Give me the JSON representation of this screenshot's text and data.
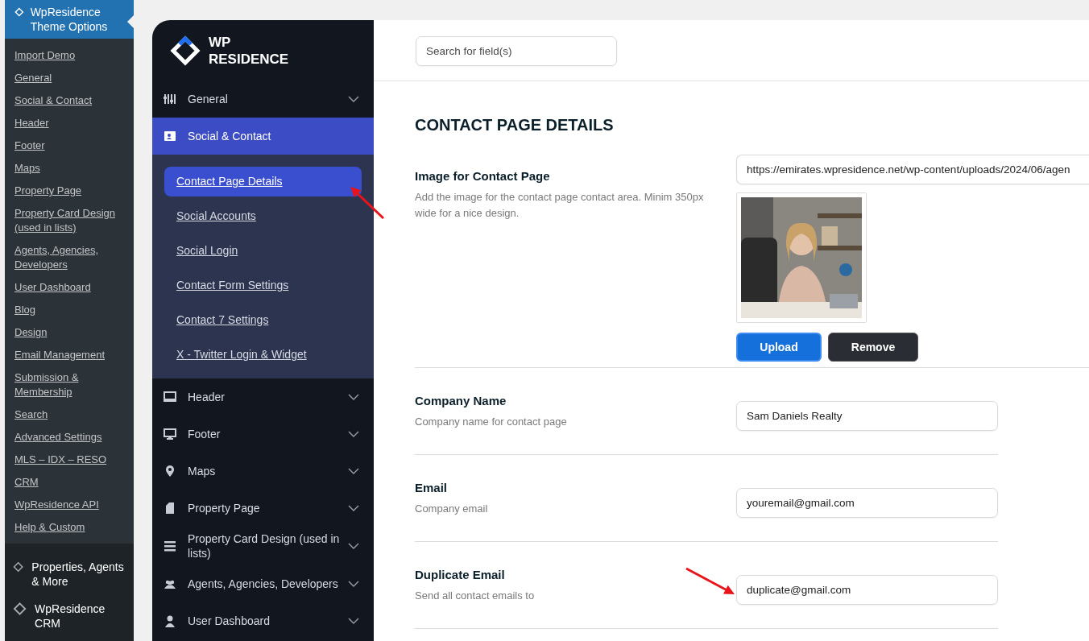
{
  "wp_menu": {
    "header": "WpResidence Theme Options",
    "items": [
      {
        "label": "Import Demo",
        "selected": false
      },
      {
        "label": "General",
        "selected": false
      },
      {
        "label": "Social & Contact",
        "selected": false
      },
      {
        "label": "Header",
        "selected": false
      },
      {
        "label": "Footer",
        "selected": false
      },
      {
        "label": "Maps",
        "selected": false
      },
      {
        "label": "Property Page",
        "selected": false
      },
      {
        "label": "Property Card Design (used in lists)",
        "selected": false
      },
      {
        "label": "Agents, Agencies, Developers",
        "selected": false
      },
      {
        "label": "User Dashboard",
        "selected": false
      },
      {
        "label": "Blog",
        "selected": false
      },
      {
        "label": "Design",
        "selected": false
      },
      {
        "label": "Email Management",
        "selected": false
      },
      {
        "label": "Submission & Membership",
        "selected": false
      },
      {
        "label": "Search",
        "selected": false
      },
      {
        "label": "Advanced Settings",
        "selected": false
      },
      {
        "label": "MLS – IDX – RESO",
        "selected": false
      },
      {
        "label": "CRM",
        "selected": false
      },
      {
        "label": "WpResidence API",
        "selected": false
      },
      {
        "label": "Help & Custom",
        "selected": false
      }
    ],
    "extra": [
      "Properties, Agents & More",
      "WpResidence CRM"
    ]
  },
  "theme_nav": {
    "logo": [
      "WP",
      "RESIDENCE"
    ],
    "items": [
      {
        "label": "General",
        "selected": false,
        "expanded": false
      },
      {
        "label": "Social & Contact",
        "selected": true,
        "expanded": true,
        "children": [
          {
            "label": "Contact Page Details",
            "selected": true
          },
          {
            "label": "Social Accounts",
            "selected": false
          },
          {
            "label": "Social Login",
            "selected": false
          },
          {
            "label": "Contact Form Settings",
            "selected": false
          },
          {
            "label": "Contact 7 Settings",
            "selected": false
          },
          {
            "label": "X - Twitter Login & Widget",
            "selected": false
          }
        ]
      },
      {
        "label": "Header",
        "selected": false,
        "expanded": false
      },
      {
        "label": "Footer",
        "selected": false,
        "expanded": false
      },
      {
        "label": "Maps",
        "selected": false,
        "expanded": false
      },
      {
        "label": "Property Page",
        "selected": false,
        "expanded": false
      },
      {
        "label": "Property Card Design (used in lists)",
        "selected": false,
        "expanded": false
      },
      {
        "label": "Agents, Agencies, Developers",
        "selected": false,
        "expanded": false
      },
      {
        "label": "User Dashboard",
        "selected": false,
        "expanded": false
      }
    ]
  },
  "search": {
    "placeholder": "Search for field(s)"
  },
  "section_title": "CONTACT PAGE DETAILS",
  "fields": [
    {
      "label": "Image for Contact Page",
      "description": "Add the image for the contact page contact area. Minim 350px wide for a nice design.",
      "value": "https://emirates.wpresidence.net/wp-content/uploads/2024/06/agen",
      "buttons": [
        "Upload",
        "Remove"
      ]
    },
    {
      "kind": "text",
      "label": "Company Name",
      "description": "Company name for contact page",
      "value": "Sam Daniels Realty"
    },
    {
      "kind": "text",
      "label": "Email",
      "description": "Company email",
      "value": "youremail@gmail.com"
    },
    {
      "kind": "text",
      "label": "Duplicate Email",
      "description": "Send all contact emails to",
      "value": "duplicate@gmail.com"
    }
  ]
}
